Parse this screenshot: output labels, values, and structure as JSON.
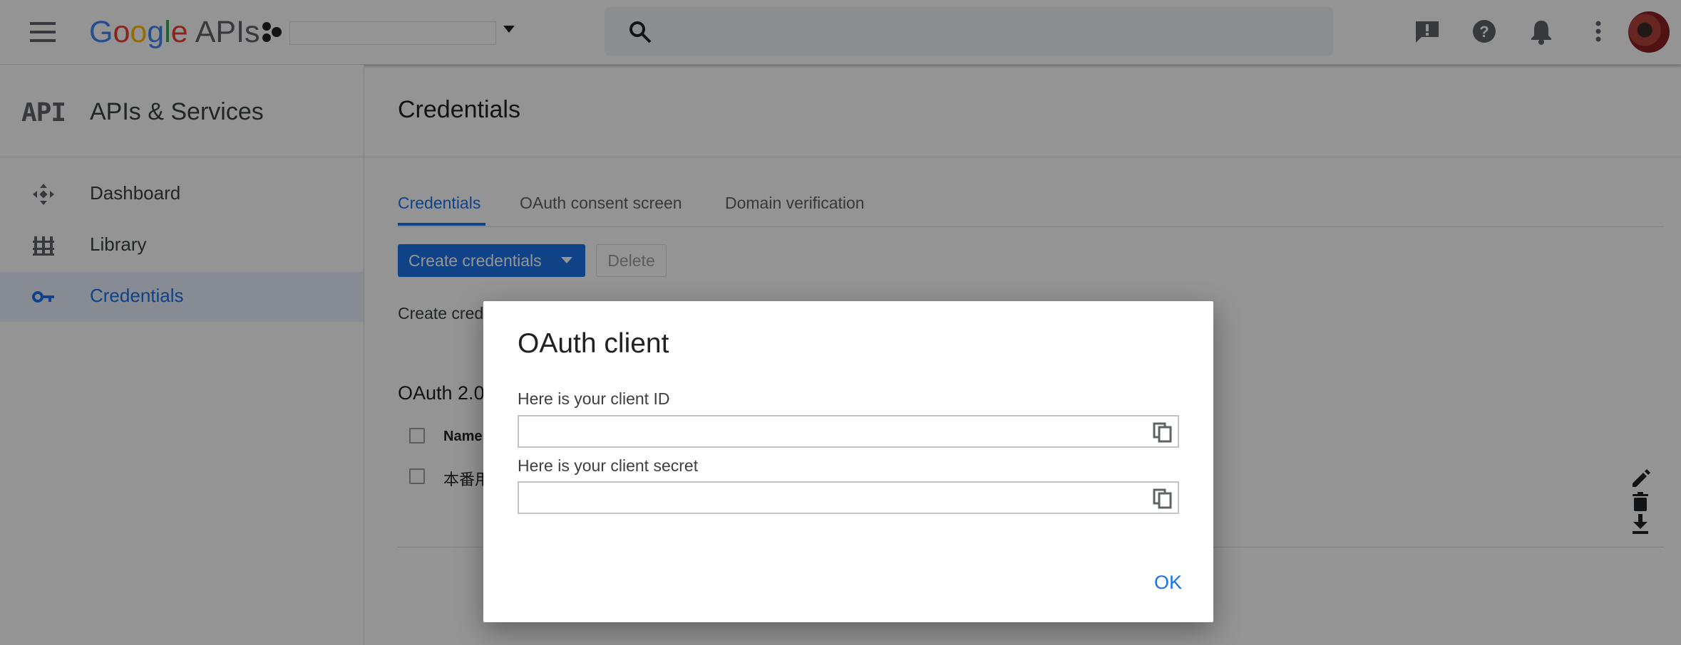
{
  "header": {
    "brand_google_letters": [
      "G",
      "o",
      "o",
      "g",
      "l",
      "e"
    ],
    "brand_apis": "APIs"
  },
  "sidebar": {
    "logo_text": "API",
    "title": "APIs & Services",
    "items": [
      {
        "label": "Dashboard",
        "icon": "dashboard-icon"
      },
      {
        "label": "Library",
        "icon": "library-icon"
      },
      {
        "label": "Credentials",
        "icon": "key-icon",
        "active": true
      }
    ]
  },
  "main": {
    "title": "Credentials",
    "tabs": [
      {
        "label": "Credentials",
        "active": true
      },
      {
        "label": "OAuth consent screen"
      },
      {
        "label": "Domain verification"
      }
    ],
    "create_button": "Create credentials",
    "delete_button": "Delete",
    "help_text": "Create cred",
    "section_title": "OAuth 2.0",
    "table": {
      "column_name": "Name",
      "rows": [
        {
          "name": "本番用"
        }
      ]
    }
  },
  "dialog": {
    "title": "OAuth client",
    "client_id_label": "Here is your client ID",
    "client_id_value": "",
    "client_secret_label": "Here is your client secret",
    "client_secret_value": "",
    "ok_button": "OK"
  },
  "colors": {
    "accent": "#1a73e8",
    "scrim": "rgba(0,0,0,0.42)"
  }
}
